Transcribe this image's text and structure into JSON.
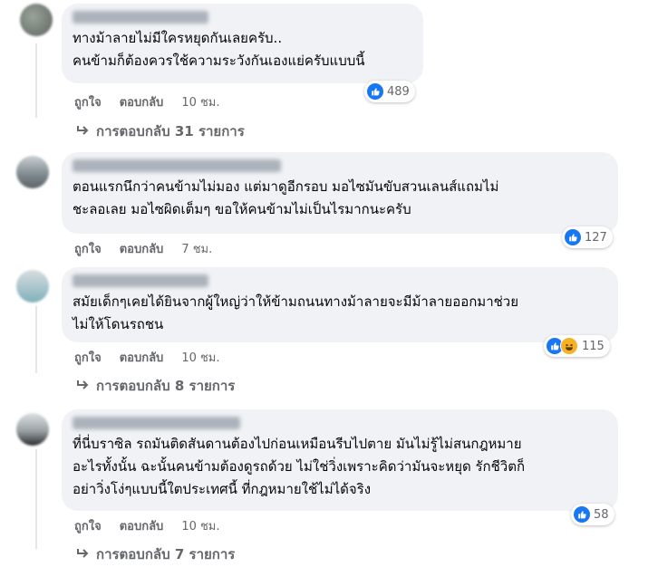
{
  "comments": [
    {
      "text": "ทางม้าลายไม่มีใครหยุดกันเลยครับ..\nคนข้ามก็ต้องควรใช้ความระวังกันเองแย่ครับแบบนี้",
      "like_label": "ถูกใจ",
      "reply_label": "ตอบกลับ",
      "time": "10 ชม.",
      "reaction_icons": [
        "like-icon"
      ],
      "reaction_count": "489",
      "replies_label": "การตอบกลับ 31 รายการ"
    },
    {
      "text": "ตอนแรกนึกว่าคนข้ามไม่มอง แต่มาดูอีกรอบ มอไซมันขับสวนเลนส์แถมไม่\nชะลอเลย มอไซผิดเต็มๆ ขอให้คนข้ามไม่เป็นไรมากนะครับ",
      "like_label": "ถูกใจ",
      "reply_label": "ตอบกลับ",
      "time": "7 ชม.",
      "reaction_icons": [
        "like-icon"
      ],
      "reaction_count": "127",
      "replies_label": ""
    },
    {
      "text": "สมัยเด็กๆเคยได้ยินจากผู้ใหญ่ว่าให้ข้ามถนนทางม้าลายจะมีม้าลายออกมาช่วย\nไม่ให้โดนรถชน",
      "like_label": "ถูกใจ",
      "reply_label": "ตอบกลับ",
      "time": "10 ชม.",
      "reaction_icons": [
        "like-icon",
        "haha-icon"
      ],
      "reaction_count": "115",
      "replies_label": "การตอบกลับ 8 รายการ"
    },
    {
      "text": "ที่นี่บราซิล รถมันติดสันดานต้องไปก่อนเหมือนรีบไปตาย มันไม่รู้ไม่สนกฎหมาย\nอะไรทั้งนั้น ฉะนั้นคนข้ามต้องดูรถด้วย ไม่ใช่วิ่งเพราะคิดว่ามันจะหยุด รักชีวิตก็\nอย่าวิ่งโง่ๆแบบนี้ใตประเทศนี้ ที่กฎหมายใช้ไม่ได้จริง",
      "like_label": "ถูกใจ",
      "reply_label": "ตอบกลับ",
      "time": "10 ชม.",
      "reaction_icons": [
        "like-icon"
      ],
      "reaction_count": "58",
      "replies_label": "การตอบกลับ 7 รายการ"
    }
  ],
  "colors": {
    "like_blue": "#1877f2",
    "haha_yellow": "#f7b125",
    "bubble_bg": "#f0f2f5",
    "meta_gray": "#65676b"
  }
}
